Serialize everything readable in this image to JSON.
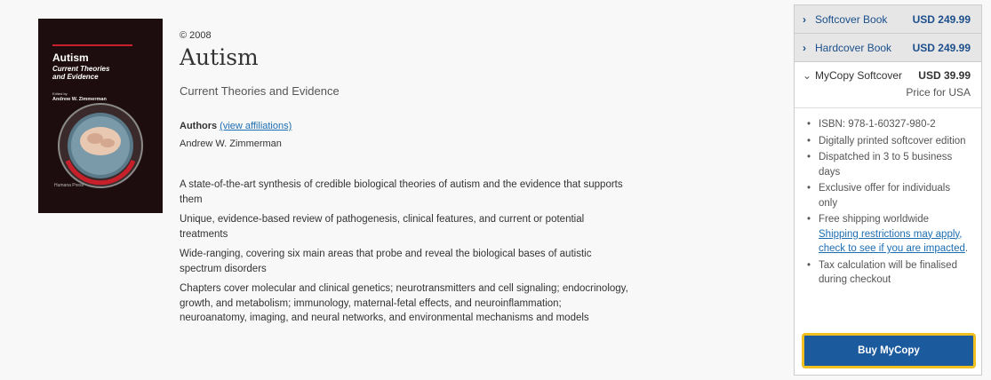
{
  "cover": {
    "title": "Autism",
    "subtitle_line1": "Current Theories",
    "subtitle_line2": "and Evidence",
    "edited_by": "Edited by",
    "author": "Andrew W. Zimmerman",
    "publisher": "Humana Press"
  },
  "book": {
    "copyright": "© 2008",
    "title": "Autism",
    "subtitle": "Current Theories and Evidence",
    "authors_label": "Authors",
    "affiliations_link": "(view affiliations)",
    "author_name": "Andrew W. Zimmerman"
  },
  "features": [
    "A state-of-the-art synthesis of credible biological theories of autism and the evidence that supports them",
    "Unique, evidence-based review of pathogenesis, clinical features, and current or potential treatments",
    "Wide-ranging, covering six main areas that probe and reveal the biological bases of autistic spectrum disorders",
    "Chapters cover molecular and clinical genetics; neurotransmitters and cell signaling; endocrinology, growth, and metabolism; immunology, maternal-fetal effects, and neuroinflammation; neuroanatomy, imaging, and neural networks, and environmental mechanisms and models"
  ],
  "purchase": {
    "softcover": {
      "label": "Softcover Book",
      "price": "USD 249.99"
    },
    "hardcover": {
      "label": "Hardcover Book",
      "price": "USD 249.99"
    },
    "mycopy": {
      "label": "MyCopy Softcover",
      "price": "USD 39.99",
      "price_note": "Price for USA",
      "bullets": [
        "ISBN: 978-1-60327-980-2",
        "Digitally printed softcover edition",
        "Dispatched in 3 to 5 business days",
        "Exclusive offer for individuals only",
        "Free shipping worldwide",
        "Tax calculation will be finalised during checkout"
      ],
      "shipping_link": "Shipping restrictions may apply, check to see if you are impacted",
      "shipping_link_suffix": "."
    },
    "buy_button": "Buy MyCopy"
  },
  "colors": {
    "link": "#1c6db2",
    "option_text": "#1c4f8b",
    "buy_button": "#1c5a9e",
    "buy_border": "#f0c020",
    "cover_bg": "#1e0d0f"
  }
}
